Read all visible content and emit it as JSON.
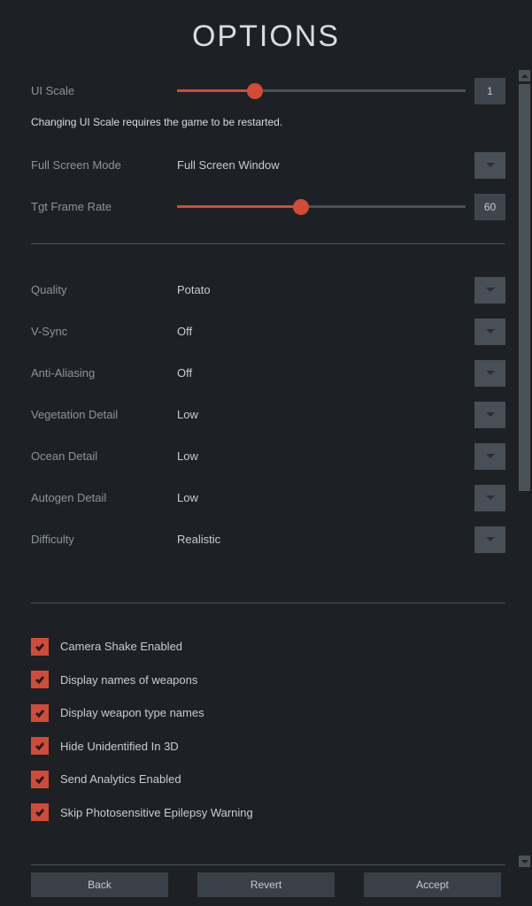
{
  "title": "OPTIONS",
  "sliders": {
    "ui_scale": {
      "label": "UI Scale",
      "value": "1",
      "fill_pct": 27
    },
    "tgt_frame": {
      "label": "Tgt Frame Rate",
      "value": "60",
      "fill_pct": 43
    }
  },
  "note": "Changing UI Scale requires the game to be restarted.",
  "dropdowns": {
    "fullscreen": {
      "label": "Full Screen Mode",
      "value": "Full Screen Window"
    },
    "quality": {
      "label": "Quality",
      "value": "Potato"
    },
    "vsync": {
      "label": "V-Sync",
      "value": "Off"
    },
    "aa": {
      "label": "Anti-Aliasing",
      "value": "Off"
    },
    "veg": {
      "label": "Vegetation Detail",
      "value": "Low"
    },
    "ocean": {
      "label": "Ocean Detail",
      "value": "Low"
    },
    "autogen": {
      "label": "Autogen Detail",
      "value": "Low"
    },
    "difficulty": {
      "label": "Difficulty",
      "value": "Realistic"
    }
  },
  "checkboxes": {
    "camera_shake": "Camera Shake Enabled",
    "weapon_names": "Display names of weapons",
    "weapon_types": "Display weapon type names",
    "hide_unid": "Hide Unidentified In 3D",
    "analytics": "Send Analytics Enabled",
    "epilepsy": "Skip Photosensitive Epilepsy Warning"
  },
  "buttons": {
    "back": "Back",
    "revert": "Revert",
    "accept": "Accept"
  }
}
